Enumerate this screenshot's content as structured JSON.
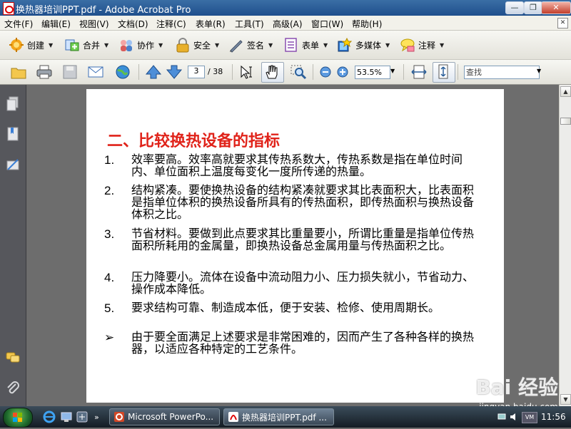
{
  "window": {
    "title": "换热器培训PPT.pdf - Adobe Acrobat Pro"
  },
  "menu": [
    "文件(F)",
    "编辑(E)",
    "视图(V)",
    "文档(D)",
    "注释(C)",
    "表单(R)",
    "工具(T)",
    "高级(A)",
    "窗口(W)",
    "帮助(H)"
  ],
  "tools": {
    "create": "创建",
    "combine": "合并",
    "collaborate": "协作",
    "secure": "安全",
    "sign": "签名",
    "forms": "表单",
    "multimedia": "多媒体",
    "comment": "注释"
  },
  "nav": {
    "page_current": "3",
    "page_total": "/ 38",
    "zoom": "53.5%",
    "find_placeholder": "查找"
  },
  "slide": {
    "title": "二、比较换热设备的指标",
    "items": [
      {
        "marker": "1.",
        "text": "效率要高。效率高就要求其传热系数大，传热系数是指在单位时间内、单位面积上温度每变化一度所传递的热量。"
      },
      {
        "marker": "2.",
        "text": "结构紧凑。要使换热设备的结构紧凑就要求其比表面积大，比表面积是指单位体积的换热设备所具有的传热面积，即传热面积与换热设备体积之比。"
      },
      {
        "marker": "3.",
        "text": "节省材料。要做到此点要求其比重量要小，所谓比重量是指单位传热面积所耗用的金属量，即换热设备总金属用量与传热面积之比。"
      },
      {
        "marker": "4.",
        "text": "压力降要小。流体在设备中流动阻力小、压力损失就小，节省动力、操作成本降低。"
      },
      {
        "marker": "5.",
        "text": "要求结构可靠、制造成本低，便于安装、检修、使用周期长。"
      },
      {
        "marker": "➢",
        "text": "由于要全面满足上述要求是非常困难的，因而产生了各种各样的换热器，以适应各种特定的工艺条件。"
      }
    ]
  },
  "watermark": {
    "line1": "Bai 经验",
    "line2": "jingyan.baidu.com"
  },
  "taskbar": {
    "buttons": [
      "Microsoft PowerPo...",
      "换热器培训PPT.pdf ..."
    ],
    "clock": "11:56"
  },
  "colors": {
    "slide_title": "#e0231a",
    "titlebar": "#2a5f9a",
    "panel": "#56575c"
  }
}
